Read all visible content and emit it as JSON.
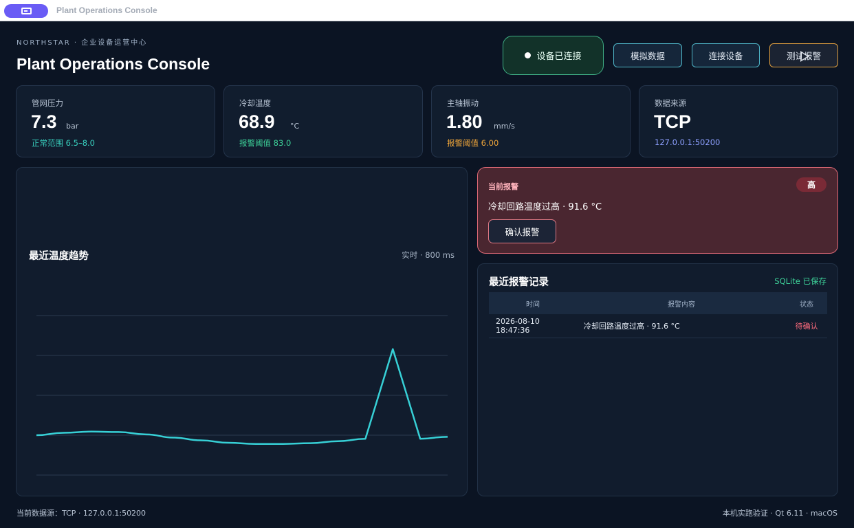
{
  "window": {
    "title": "Plant Operations Console"
  },
  "header": {
    "brand": "NORTHSTAR · 企业设备运营中心",
    "title": "Plant Operations Console",
    "status": "设备已连接",
    "buttons": {
      "simulate": "模拟数据",
      "connect": "连接设备",
      "test_alarm": "测试报警"
    }
  },
  "cards": [
    {
      "label": "管网压力",
      "value": "7.3",
      "unit": "bar",
      "sub": "正常范围 6.5–8.0",
      "sub_color": "#39d2c0"
    },
    {
      "label": "冷却温度",
      "value": "68.9",
      "unit": "°C",
      "sub": "报警阈值 83.0",
      "sub_color": "#3ed39a"
    },
    {
      "label": "主轴振动",
      "value": "1.80",
      "unit": "mm/s",
      "sub": "报警阈值 6.00",
      "sub_color": "#f0a63a"
    },
    {
      "label": "数据来源",
      "value": "TCP",
      "unit": "",
      "sub": "127.0.0.1:50200",
      "sub_color": "#8ea0ff"
    }
  ],
  "chart": {
    "title": "最近温度趋势",
    "meta": "实时 · 800 ms"
  },
  "chart_data": {
    "type": "line",
    "title": "最近温度趋势",
    "xlabel": "",
    "ylabel": "",
    "grid": true,
    "ylim": [
      60,
      100
    ],
    "series": [
      {
        "color": "#37d0d6",
        "values": [
          70.0,
          70.6,
          70.9,
          70.8,
          70.2,
          69.4,
          68.7,
          68.1,
          67.8,
          67.8,
          68.0,
          68.5,
          69.1,
          91.6,
          69.1,
          69.6
        ]
      }
    ]
  },
  "alarm": {
    "label": "当前报警",
    "severity": "高",
    "message": "冷却回路温度过高 · 91.6 °C",
    "ack": "确认报警"
  },
  "log": {
    "title": "最近报警记录",
    "saved": "SQLite 已保存",
    "headers": {
      "time": "时间",
      "message": "报警内容",
      "status": "状态"
    },
    "rows": [
      {
        "date": "2026-08-10",
        "time": "18:47:36",
        "message": "冷却回路温度过高 · 91.6 °C",
        "status": "待确认"
      }
    ]
  },
  "footer": {
    "left": "当前数据源：TCP · 127.0.0.1:50200",
    "right": "本机实跑验证 · Qt 6.11 · macOS"
  }
}
